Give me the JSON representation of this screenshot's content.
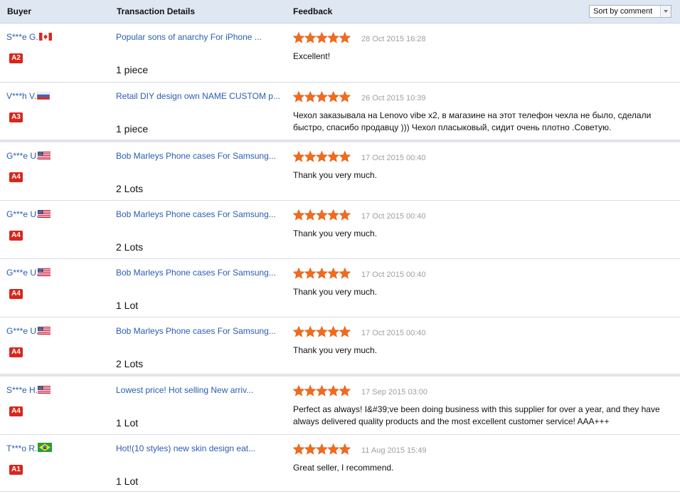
{
  "header": {
    "buyer": "Buyer",
    "transaction_details": "Transaction Details",
    "feedback": "Feedback",
    "sort": {
      "selected": "Sort by comment"
    }
  },
  "colors": {
    "link": "#2a5db0",
    "badge": "#d9261c",
    "star": "#f26b1d",
    "date": "#9aa0a6",
    "header_bg": "#dfe7f3"
  },
  "rows": [
    {
      "buyer": "S***e G.",
      "flag": "canada-flag-icon",
      "level": "A2",
      "product": "Popular sons of anarchy For iPhone ...",
      "quantity": "1 piece",
      "rating": 5,
      "date": "28 Oct 2015 16:28",
      "comment": "Excellent!"
    },
    {
      "buyer": "V***h V.",
      "flag": "russia-flag-icon",
      "level": "A3",
      "product": "Retail DIY design own NAME CUSTOM p...",
      "quantity": "1 piece",
      "rating": 5,
      "date": "26 Oct 2015 10:39",
      "comment": "Чехол заказывала на Lenovo vibe x2, в магазине на этот телефон чехла не было, сделали быстро, спасибо продавцу ))) Чехол пласыковый, сидит очень плотно .Советую."
    },
    {
      "buyer": "G***e U.",
      "flag": "usa-flag-icon",
      "level": "A4",
      "product": "Bob Marleys Phone cases For Samsung...",
      "quantity": "2 Lots",
      "rating": 5,
      "date": "17 Oct 2015 00:40",
      "comment": "Thank you very much."
    },
    {
      "buyer": "G***e U.",
      "flag": "usa-flag-icon",
      "level": "A4",
      "product": "Bob Marleys Phone cases For Samsung...",
      "quantity": "2 Lots",
      "rating": 5,
      "date": "17 Oct 2015 00:40",
      "comment": "Thank you very much."
    },
    {
      "buyer": "G***e U.",
      "flag": "usa-flag-icon",
      "level": "A4",
      "product": "Bob Marleys Phone cases For Samsung...",
      "quantity": "1 Lot",
      "rating": 5,
      "date": "17 Oct 2015 00:40",
      "comment": "Thank you very much."
    },
    {
      "buyer": "G***e U.",
      "flag": "usa-flag-icon",
      "level": "A4",
      "product": "Bob Marleys Phone cases For Samsung...",
      "quantity": "2 Lots",
      "rating": 5,
      "date": "17 Oct 2015 00:40",
      "comment": "Thank you very much."
    },
    {
      "buyer": "S***e H.",
      "flag": "usa-flag-icon",
      "level": "A4",
      "product": "Lowest price! Hot selling New arriv...",
      "quantity": "1 Lot",
      "rating": 5,
      "date": "17 Sep 2015 03:00",
      "comment": "Perfect as always! I&#39;ve been doing business with this supplier for over a year, and they have always delivered quality products and the most excellent customer service! AAA+++"
    },
    {
      "buyer": "T***o R.",
      "flag": "brazil-flag-icon",
      "level": "A1",
      "product": "Hot!(10 styles) new skin design eat...",
      "quantity": "1 Lot",
      "rating": 5,
      "date": "11 Aug 2015 15:49",
      "comment": "Great seller, I recommend."
    }
  ]
}
